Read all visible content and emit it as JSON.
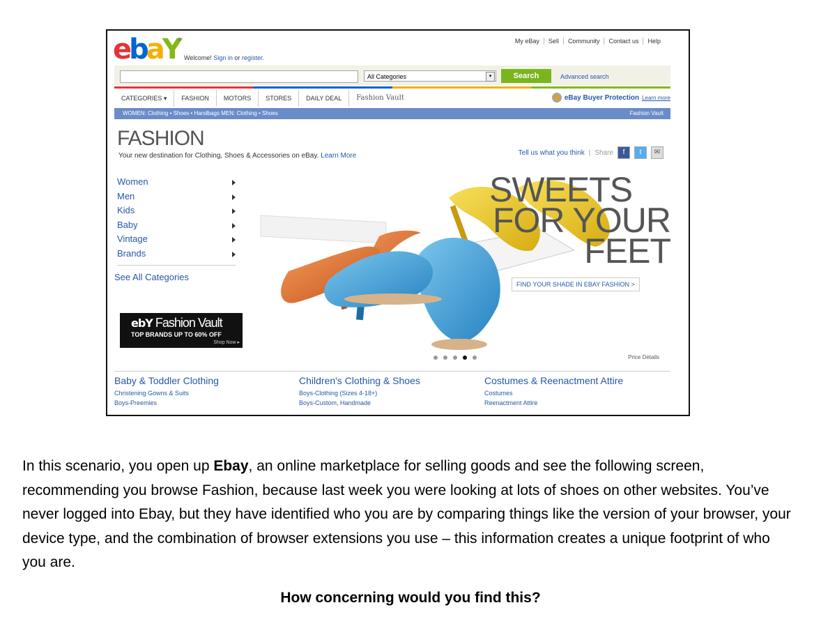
{
  "screenshot": {
    "logo_text": "ebY",
    "welcome": {
      "prefix": "Welcome!",
      "sign_in": "Sign in",
      "or": "or",
      "register": "register."
    },
    "top_links": [
      "My eBay",
      "Sell",
      "Community",
      "Contact us",
      "Help"
    ],
    "search": {
      "category": "All Categories",
      "button": "Search",
      "advanced": "Advanced search"
    },
    "nav_tabs": [
      "CATEGORIES",
      "FASHION",
      "MOTORS",
      "STORES",
      "DAILY DEAL",
      "Fashion Vault"
    ],
    "buyer_protection": {
      "label": "eBay Buyer Protection",
      "learn": "Learn more"
    },
    "subnav": {
      "left": "WOMEN:  Clothing • Shoes • Handbags      MEN:  Clothing • Shoes",
      "right": "Fashion Vault"
    },
    "fashion": {
      "title": "FASHION",
      "description": "Your new destination for Clothing, Shoes & Accessories on eBay.",
      "learn": "Learn More"
    },
    "share": {
      "tell": "Tell us what you think",
      "share": "Share"
    },
    "left_nav": [
      "Women",
      "Men",
      "Kids",
      "Baby",
      "Vintage",
      "Brands"
    ],
    "see_all": "See All Categories",
    "vault_banner": {
      "title": "Fashion Vault",
      "subtitle": "TOP BRANDS UP TO 60% OFF",
      "cta": "Shop Now ▸"
    },
    "hero": {
      "line1": "SWEETS",
      "line2": "FOR YOUR",
      "line3": "FEET",
      "cta": "FIND YOUR SHADE IN EBAY FASHION >"
    },
    "carousel": {
      "count": 5,
      "active": 3
    },
    "price_details": "Price Details",
    "columns": [
      {
        "heading": "Baby & Toddler Clothing",
        "links": [
          "Christening Gowns & Suits",
          "Boys-Preemies"
        ]
      },
      {
        "heading": "Children's Clothing & Shoes",
        "links": [
          "Boys-Clothing (Sizes 4-18+)",
          "Boys-Custom, Handmade"
        ]
      },
      {
        "heading": "Costumes & Reenactment Attire",
        "links": [
          "Costumes",
          "Reenactment Attire"
        ]
      }
    ]
  },
  "paragraph": {
    "before": "In this scenario, you open up ",
    "bold": "Ebay",
    "after": ", an online marketplace for selling goods and see the following screen, recommending you browse Fashion, because last week you were looking at lots of shoes on other websites. You’ve never logged into Ebay, but they have identified who you are by comparing things like the version of your browser, your device type, and the combination of browser extensions you use – this information creates a unique footprint of who you are."
  },
  "question": "How concerning would you find this?"
}
